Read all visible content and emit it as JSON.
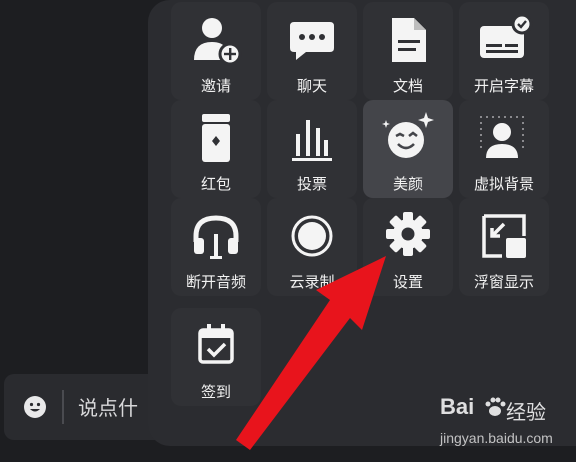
{
  "input_bar": {
    "placeholder": "说点什",
    "emoji_icon": "smiley-icon"
  },
  "menu": {
    "items": [
      {
        "label": "邀请",
        "icon": "add-user-icon"
      },
      {
        "label": "聊天",
        "icon": "chat-bubble-icon"
      },
      {
        "label": "文档",
        "icon": "document-icon"
      },
      {
        "label": "开启字幕",
        "icon": "captions-icon"
      },
      {
        "label": "红包",
        "icon": "red-envelope-icon"
      },
      {
        "label": "投票",
        "icon": "bar-chart-icon"
      },
      {
        "label": "美颜",
        "icon": "beauty-face-icon"
      },
      {
        "label": "虚拟背景",
        "icon": "virtual-background-icon"
      },
      {
        "label": "断开音频",
        "icon": "headphones-icon"
      },
      {
        "label": "云录制",
        "icon": "record-icon"
      },
      {
        "label": "设置",
        "icon": "gear-icon"
      },
      {
        "label": "浮窗显示",
        "icon": "floating-window-icon"
      },
      {
        "label": "签到",
        "icon": "calendar-check-icon"
      }
    ],
    "active_label": "美颜"
  },
  "annotation": {
    "arrow_color": "#e8141c",
    "points_to": "设置"
  },
  "watermark": {
    "brand": "Bai",
    "brand_suffix": "经验",
    "url": "jingyan.baidu.com"
  },
  "colors": {
    "background": "#1d1e21",
    "panel": "#2b2c30",
    "tile": "#303135",
    "tile_active": "#44454a",
    "icon": "#f4f4f4"
  }
}
